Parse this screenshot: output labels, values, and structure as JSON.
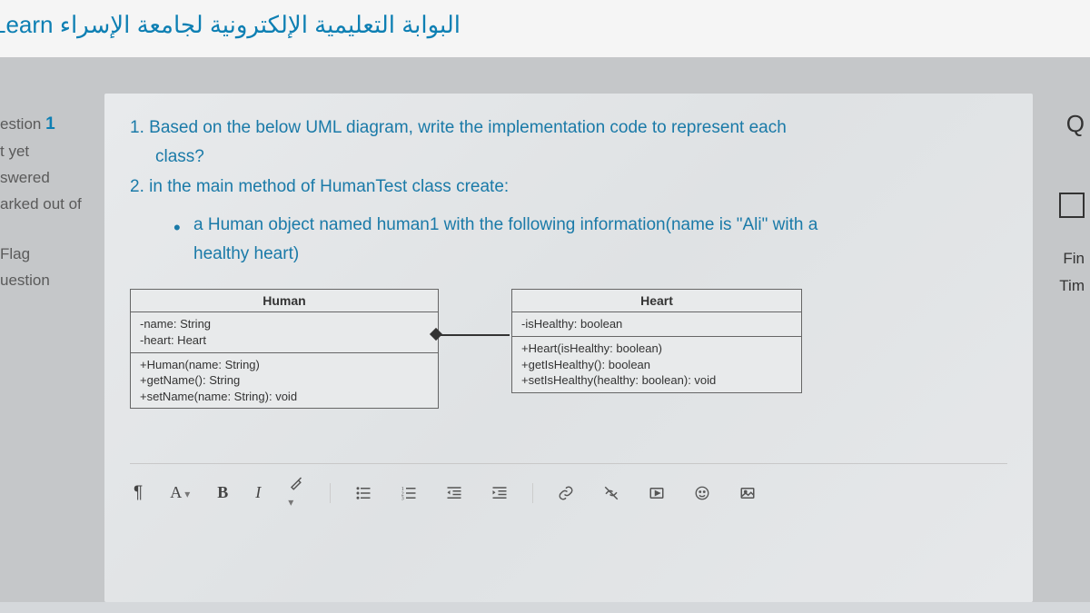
{
  "header": {
    "site_title": "البوابة التعليمية الإلكترونية لجامعة الإسراء Learn"
  },
  "sidebar": {
    "question_label": "estion",
    "question_num": "1",
    "not_yet": "t yet",
    "answered": "swered",
    "marked": "arked out of",
    "flag": "Flag",
    "flag_question": "uestion"
  },
  "right": {
    "q": "Q",
    "fin": "Fin",
    "tim": "Tim"
  },
  "question": {
    "line1_num": "1.",
    "line1": "Based on the below UML diagram, write the implementation code to represent each",
    "line1b": "class?",
    "line2_num": "2.",
    "line2": "in the main method of HumanTest  class create:",
    "bullet1a": "a Human object named human1 with the following information(name is \"Ali\" with a",
    "bullet1b": "healthy heart)"
  },
  "uml": {
    "human": {
      "title": "Human",
      "attrs": "-name: String\n-heart: Heart",
      "ops": "+Human(name: String)\n+getName(): String\n+setName(name: String): void"
    },
    "heart": {
      "title": "Heart",
      "attrs": "-isHealthy: boolean",
      "ops": "+Heart(isHealthy: boolean)\n+getIsHealthy(): boolean\n+setIsHealthy(healthy: boolean): void"
    }
  },
  "toolbar": {
    "para": "¶",
    "font": "A",
    "bold": "B",
    "italic": "I"
  }
}
